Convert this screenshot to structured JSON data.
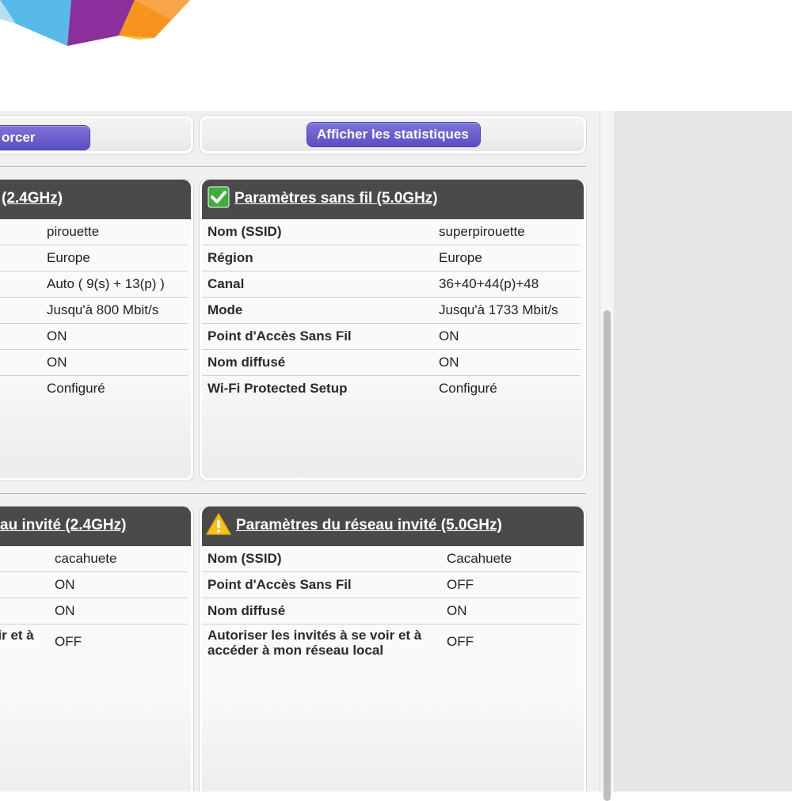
{
  "brand": {
    "colors": [
      "#59b9ea",
      "#8b2f9c",
      "#f7941d",
      "#fbc42c",
      "#b6dff5"
    ]
  },
  "toolbar": {
    "left_button_label": "orcer",
    "stats_button_label": "Afficher les statistiques"
  },
  "wireless_24": {
    "title": "(2.4GHz)",
    "values": [
      "pirouette",
      "Europe",
      "Auto ( 9(s) + 13(p) )",
      "Jusqu'à 800 Mbit/s",
      "ON",
      "ON",
      "Configuré"
    ]
  },
  "wireless_50": {
    "title": "Paramètres sans fil (5.0GHz)",
    "status_icon": "check-icon",
    "rows": [
      {
        "label": "Nom (SSID)",
        "value": "superpirouette"
      },
      {
        "label": "Région",
        "value": "Europe"
      },
      {
        "label": "Canal",
        "value": "36+40+44(p)+48"
      },
      {
        "label": "Mode",
        "value": "Jusqu'à 1733 Mbit/s"
      },
      {
        "label": "Point d'Accès Sans Fil",
        "value": "ON"
      },
      {
        "label": "Nom diffusé",
        "value": "ON"
      },
      {
        "label": "Wi-Fi Protected Setup",
        "value": "Configuré"
      }
    ]
  },
  "guest_24": {
    "title": "au invité (2.4GHz)",
    "values": [
      "cacahuete",
      "ON",
      "ON",
      "OFF"
    ],
    "partial_label": "oir et à"
  },
  "guest_50": {
    "title": "Paramètres du réseau invité (5.0GHz)",
    "status_icon": "warning-icon",
    "rows": [
      {
        "label": "Nom (SSID)",
        "value": "Cacahuete"
      },
      {
        "label": "Point d'Accès Sans Fil",
        "value": "OFF"
      },
      {
        "label": "Nom diffusé",
        "value": "ON"
      },
      {
        "label": "Autoriser les invités à se voir et à accéder à mon réseau local",
        "value": "OFF"
      }
    ]
  },
  "colors": {
    "header_bg": "#4a4a4a",
    "button": "#5b4ec4",
    "check": "#3cae3c",
    "warning": "#f4c21b"
  }
}
